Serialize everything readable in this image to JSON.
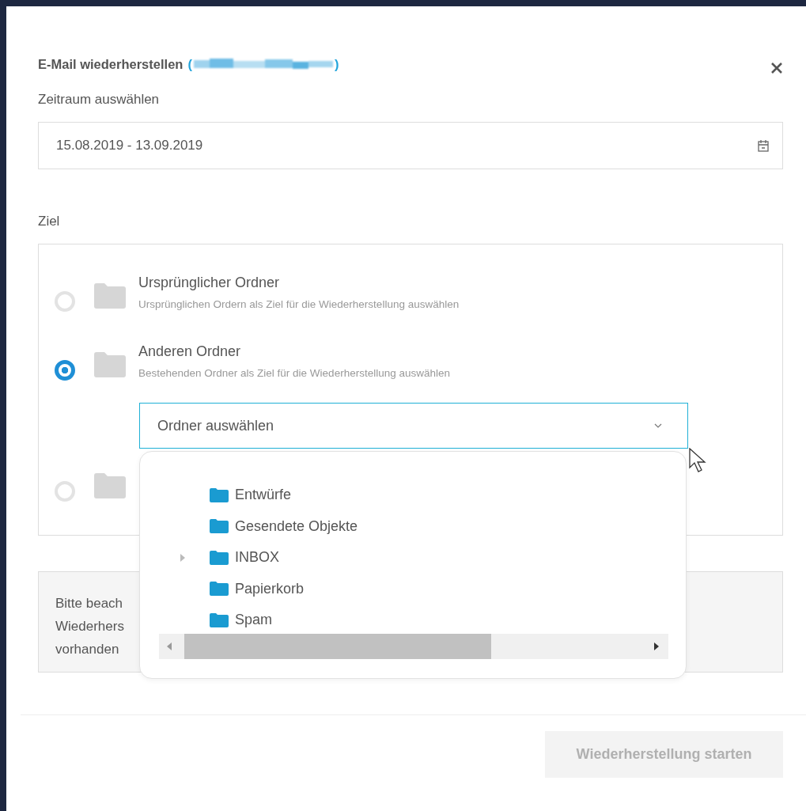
{
  "dialog": {
    "title": "E-Mail wiederherstellen",
    "account_open": "(",
    "account_close": ")"
  },
  "period": {
    "label": "Zeitraum auswählen",
    "value": "15.08.2019 - 13.09.2019"
  },
  "target": {
    "label": "Ziel",
    "options": [
      {
        "title": "Ursprünglicher Ordner",
        "description": "Ursprünglichen Ordern als Ziel für die Wiederherstellung auswählen",
        "selected": false
      },
      {
        "title": "Anderen Ordner",
        "description": "Bestehenden Ordner als Ziel für die Wiederherstellung auswählen",
        "selected": true
      },
      {
        "selected": false
      }
    ],
    "folder_select": {
      "placeholder": "Ordner auswählen"
    }
  },
  "folder_menu": {
    "items": [
      {
        "label": "Entwürfe"
      },
      {
        "label": "Gesendete Objekte"
      },
      {
        "label": "INBOX",
        "expanded": false
      },
      {
        "label": "Papierkorb"
      },
      {
        "label": "Spam"
      }
    ]
  },
  "notice": {
    "lines": [
      "Bitte beach",
      "Wiederhers",
      "vorhanden"
    ]
  },
  "footer": {
    "button": {
      "label": "Wiederherstellung starten",
      "disabled": true
    }
  }
}
